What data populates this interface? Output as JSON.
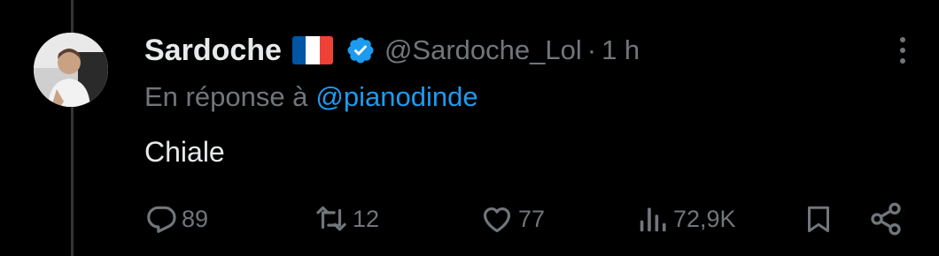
{
  "tweet": {
    "author": {
      "display_name": "Sardoche",
      "flag": "france-flag-icon",
      "verified": true,
      "handle": "@Sardoche_Lol",
      "separator": "·",
      "time": "1 h"
    },
    "reply_context": {
      "prefix": "En réponse à",
      "mention": "@pianodinde"
    },
    "text": "Chiale",
    "actions": {
      "replies": "89",
      "retweets": "12",
      "likes": "77",
      "views": "72,9K"
    }
  },
  "colors": {
    "background": "#000000",
    "text_primary": "#e7e9ea",
    "text_secondary": "#71767b",
    "accent": "#1d9bf0",
    "thread_line": "#333639",
    "flag_blue": "#0055a4",
    "flag_white": "#ffffff",
    "flag_red": "#ef4135"
  },
  "icons": {
    "reply": "speech-bubble-icon",
    "retweet": "retweet-arrows-icon",
    "like": "heart-icon",
    "views": "bar-chart-icon",
    "bookmark": "bookmark-icon",
    "share": "share-icon",
    "more": "more-dots-icon",
    "verified": "verified-badge-icon"
  }
}
